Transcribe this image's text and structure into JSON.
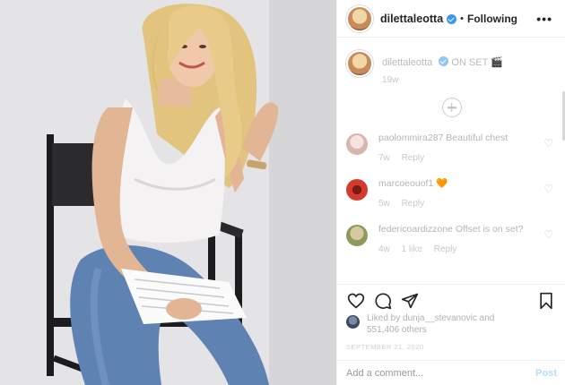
{
  "post": {
    "image_alt": "Photo of a woman with long blonde hair in a white top and jeans sitting on a director's chair holding papers"
  },
  "header": {
    "username": "dilettaleotta",
    "separator": "•",
    "follow_label": "Following",
    "more_label": "•••"
  },
  "caption": {
    "username": "dilettaleotta",
    "text": "ON SET 🎬",
    "time": "19w"
  },
  "comments": [
    {
      "username": "paolommira287",
      "text": "Beautiful chest",
      "time": "7w",
      "reply_label": "Reply",
      "likes_label": "",
      "avatar_color": "#e8d6d0"
    },
    {
      "username": "marcoeouof1",
      "text": "🧡",
      "time": "5w",
      "reply_label": "Reply",
      "likes_label": "",
      "avatar_color": "#d23b2e"
    },
    {
      "username": "federicoardizzone",
      "text": "Offset is on set?",
      "time": "4w",
      "reply_label": "Reply",
      "likes_label": "1 like",
      "avatar_color": "#a9b07a"
    }
  ],
  "likes": {
    "line1": "Liked by dunja__stevanovic and",
    "line2": "551,406 others"
  },
  "date": "SEPTEMBER 21, 2020",
  "add_comment": {
    "placeholder": "Add a comment...",
    "post_label": "Post"
  },
  "colors": {
    "verified": "#3897f0",
    "post_button": "#b2dffc"
  }
}
